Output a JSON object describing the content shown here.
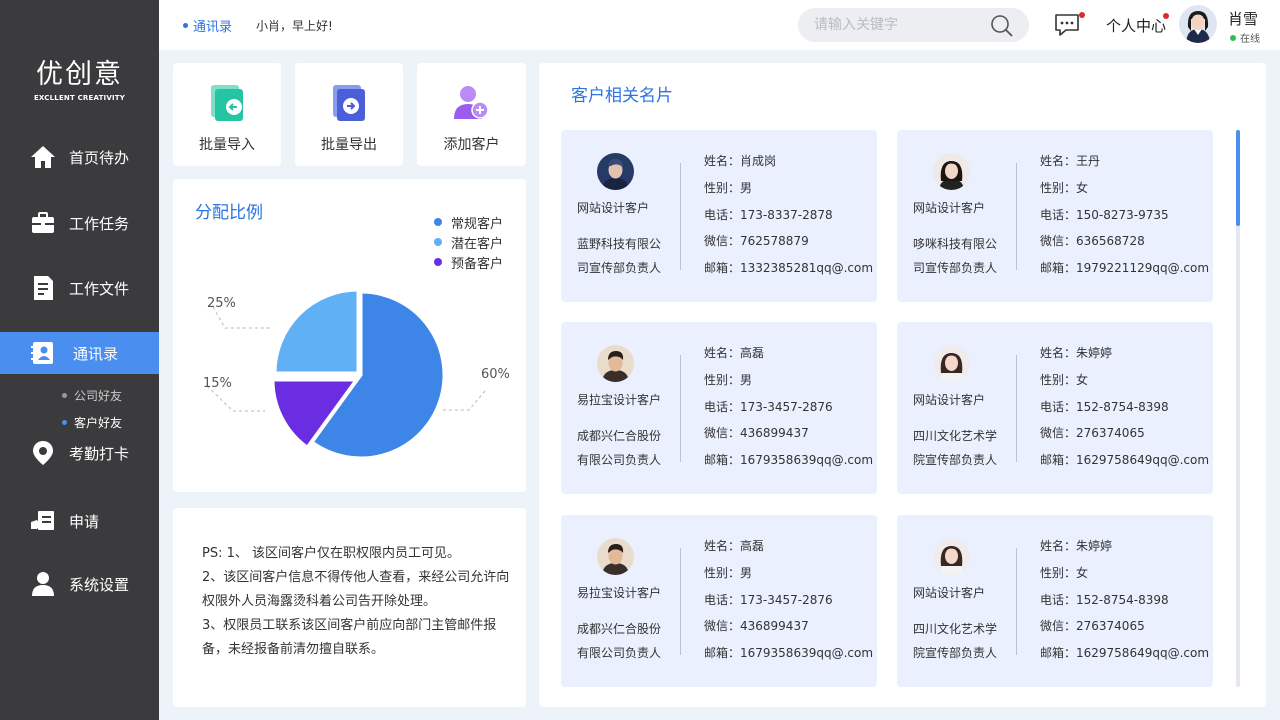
{
  "logo": {
    "main": "优创意",
    "sub": "EXCLLENT CREATIVITY"
  },
  "nav": [
    {
      "label": "首页待办",
      "icon": "home-icon"
    },
    {
      "label": "工作任务",
      "icon": "briefcase-icon"
    },
    {
      "label": "工作文件",
      "icon": "document-icon"
    },
    {
      "label": "通讯录",
      "icon": "contacts-icon",
      "active": true
    },
    {
      "label": "考勤打卡",
      "icon": "location-pin-icon"
    },
    {
      "label": "申请",
      "icon": "application-icon"
    },
    {
      "label": "系统设置",
      "icon": "user-settings-icon"
    }
  ],
  "subnav": [
    {
      "label": "公司好友"
    },
    {
      "label": "客户好友",
      "active": true
    }
  ],
  "header": {
    "crumb": "通讯录",
    "greeting": "小肖，早上好!",
    "search_placeholder": "请输入关键字",
    "center": "个人中心",
    "user_name": "肖雪",
    "user_status": "在线"
  },
  "actions": [
    {
      "label": "批量导入",
      "icon": "import-icon",
      "color": "#25c4a3"
    },
    {
      "label": "批量导出",
      "icon": "export-icon",
      "color": "#4a5fd8"
    },
    {
      "label": "添加客户",
      "icon": "add-user-icon",
      "color": "#9b5cf0"
    }
  ],
  "distribution": {
    "title": "分配比例",
    "legend": [
      {
        "name": "常规客户",
        "color": "#3d86e8"
      },
      {
        "name": "潜在客户",
        "color": "#5fb0f4"
      },
      {
        "name": "预备客户",
        "color": "#6b2de2"
      }
    ]
  },
  "chart_data": {
    "type": "pie",
    "title": "分配比例",
    "slices": [
      {
        "name": "常规客户",
        "value": 60,
        "label": "60%",
        "color": "#3d86e8"
      },
      {
        "name": "预备客户",
        "value": 15,
        "label": "15%",
        "color": "#6b2de2"
      },
      {
        "name": "潜在客户",
        "value": 25,
        "label": "25%",
        "color": "#5fb0f4"
      }
    ],
    "legend_position": "top-right"
  },
  "notes": {
    "lines": [
      "PS: 1、 该区间客户仅在职权限内员工可见。",
      "2、该区间客户信息不得传他人查看，来经公司允许向权限外人员海露烫科着公司告开除处理。",
      "3、权限员工联系该区间客户前应向部门主管邮件报备，未经报备前清勿擅自联系。"
    ]
  },
  "contacts": {
    "title": "客户相关名片",
    "cards": [
      {
        "type": "网站设计客户",
        "company": "蓝野科技有限公司宣传部负责人",
        "name": "姓名：肖成岗",
        "gender": "性别：男",
        "phone": "电话：173-8337-2878",
        "wechat": "微信：762578879",
        "email": "邮箱：1332385281qq@.com",
        "avatar": "avatar-male-1"
      },
      {
        "type": "网站设计客户",
        "company": "哆咪科技有限公司宣传部负责人",
        "name": "姓名：王丹",
        "gender": "性别：女",
        "phone": "电话：150-8273-9735",
        "wechat": "微信：636568728",
        "email": "邮箱：1979221129qq@.com",
        "avatar": "avatar-female-1"
      },
      {
        "type": "易拉宝设计客户",
        "company": "成都兴仁合股份有限公司负责人",
        "name": "姓名：高磊",
        "gender": "性别：男",
        "phone": "电话：173-3457-2876",
        "wechat": "微信：436899437",
        "email": "邮箱：1679358639qq@.com",
        "avatar": "avatar-male-2"
      },
      {
        "type": "网站设计客户",
        "company": "四川文化艺术学院宣传部负责人",
        "name": "姓名：朱婷婷",
        "gender": "性别：女",
        "phone": "电话：152-8754-8398",
        "wechat": "微信：276374065",
        "email": "邮箱：1629758649qq@.com",
        "avatar": "avatar-female-2"
      },
      {
        "type": "易拉宝设计客户",
        "company": "成都兴仁合股份有限公司负责人",
        "name": "姓名：高磊",
        "gender": "性别：男",
        "phone": "电话：173-3457-2876",
        "wechat": "微信：436899437",
        "email": "邮箱：1679358639qq@.com",
        "avatar": "avatar-male-2"
      },
      {
        "type": "网站设计客户",
        "company": "四川文化艺术学院宣传部负责人",
        "name": "姓名：朱婷婷",
        "gender": "性别：女",
        "phone": "电话：152-8754-8398",
        "wechat": "微信：276374065",
        "email": "邮箱：1629758649qq@.com",
        "avatar": "avatar-female-2"
      }
    ]
  }
}
